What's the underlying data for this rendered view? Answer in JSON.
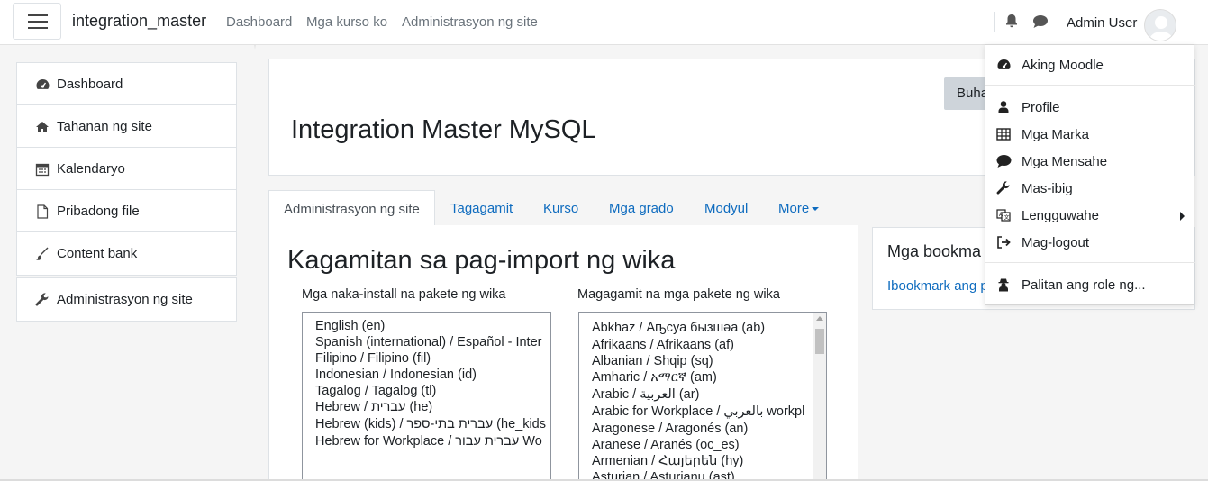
{
  "navbar": {
    "brand": "integration_master",
    "links": [
      "Dashboard",
      "Mga kurso ko",
      "Administrasyon ng site"
    ],
    "user_name": "Admin User"
  },
  "sidebar": {
    "items": [
      {
        "label": "Dashboard",
        "icon": "dashboard-icon"
      },
      {
        "label": "Tahanan ng site",
        "icon": "home-icon"
      },
      {
        "label": "Kalendaryo",
        "icon": "calendar-icon"
      },
      {
        "label": "Pribadong file",
        "icon": "file-icon"
      },
      {
        "label": "Content bank",
        "icon": "paintbrush-icon"
      }
    ],
    "admin_item": {
      "label": "Administrasyon ng site",
      "icon": "wrench-icon"
    }
  },
  "header": {
    "title": "Integration Master MySQL",
    "edit_button": "Buha"
  },
  "tabs": [
    {
      "label": "Administrasyon ng site",
      "active": true
    },
    {
      "label": "Tagagamit"
    },
    {
      "label": "Kurso"
    },
    {
      "label": "Mga grado"
    },
    {
      "label": "Modyul"
    },
    {
      "label": "More"
    }
  ],
  "content": {
    "title": "Kagamitan sa pag-import ng wika",
    "installed_label": "Mga naka-install na pakete ng wika",
    "available_label": "Magagamit na mga pakete ng wika",
    "installed": [
      "English ‎(en)‎",
      "Spanish (international) / Español - Inter",
      "Filipino / Filipino ‎(fil)‎",
      "Indonesian / Indonesian ‎(id)‎",
      "Tagalog / Tagalog ‎(tl)‎",
      "Hebrew / ‏עברית‏ ‎(he)‎",
      "Hebrew (kids) / ‏עברית בתי-ספר‏ ‎(he_kids",
      "Hebrew for Workplace / ‏עברית עבור‏ Wo"
    ],
    "available": [
      "Abkhaz / Аҧсуа бызшәа (ab)",
      "Afrikaans / Afrikaans (af)",
      "Albanian / Shqip (sq)",
      "Amharic / አማርኛ (am)",
      "Arabic / العربية (ar)",
      "Arabic for Workplace / بالعربي workpl",
      "Aragonese / Aragonés (an)",
      "Aranese / Aranés (oc_es)",
      "Armenian / Հայերեն (hy)",
      "Asturian / Asturianu (ast)"
    ]
  },
  "bookmarks": {
    "title": "Mga bookma",
    "link": "Ibookmark ang p"
  },
  "user_menu": {
    "items": [
      {
        "label": "Aking Moodle",
        "icon": "dashboard-icon"
      },
      {
        "label": "Profile",
        "icon": "user-icon"
      },
      {
        "label": "Mga Marka",
        "icon": "table-icon"
      },
      {
        "label": "Mga Mensahe",
        "icon": "chat-icon"
      },
      {
        "label": "Mas-ibig",
        "icon": "wrench-icon"
      },
      {
        "label": "Lengguwahe",
        "icon": "language-icon"
      },
      {
        "label": "Mag-logout",
        "icon": "logout-icon"
      },
      {
        "label": "Palitan ang role ng...",
        "icon": "user-secret-icon"
      }
    ]
  }
}
